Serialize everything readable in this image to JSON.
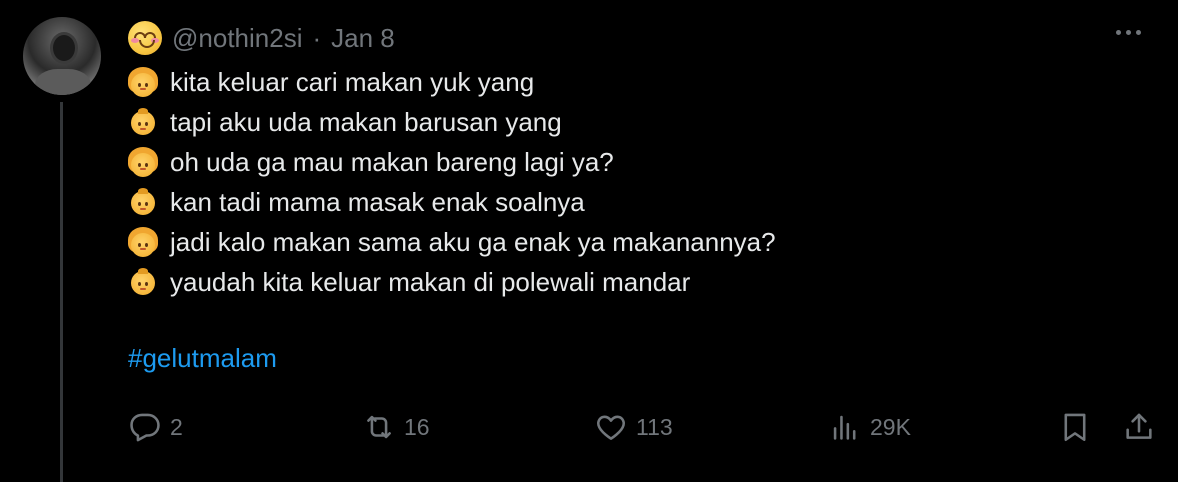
{
  "tweet": {
    "handle": "@nothin2si",
    "separator": "·",
    "date": "Jan 8",
    "lines": [
      {
        "speaker": "girl",
        "emoji": "girl-emoji",
        "text": "kita keluar cari makan yuk yang"
      },
      {
        "speaker": "boy",
        "emoji": "boy-emoji",
        "text": "tapi aku uda makan barusan yang"
      },
      {
        "speaker": "girl",
        "emoji": "girl-emoji",
        "text": "oh uda ga mau makan bareng lagi ya?"
      },
      {
        "speaker": "boy",
        "emoji": "boy-emoji",
        "text": "kan tadi mama masak enak soalnya"
      },
      {
        "speaker": "girl",
        "emoji": "girl-emoji",
        "text": "jadi kalo makan sama aku ga enak ya makanannya?"
      },
      {
        "speaker": "boy",
        "emoji": "boy-emoji",
        "text": "yaudah kita keluar makan di polewali mandar"
      }
    ],
    "hashtag": "#gelutmalam"
  },
  "actions": {
    "replies": "2",
    "retweets": "16",
    "likes": "113",
    "views": "29K"
  },
  "colors": {
    "background": "#000000",
    "text": "#e7e9ea",
    "muted": "#71767b",
    "link": "#1d9bf0"
  },
  "icons": [
    "smiling-face-icon",
    "more-icon",
    "reply-icon",
    "retweet-icon",
    "like-icon",
    "views-icon",
    "bookmark-icon",
    "share-icon"
  ]
}
